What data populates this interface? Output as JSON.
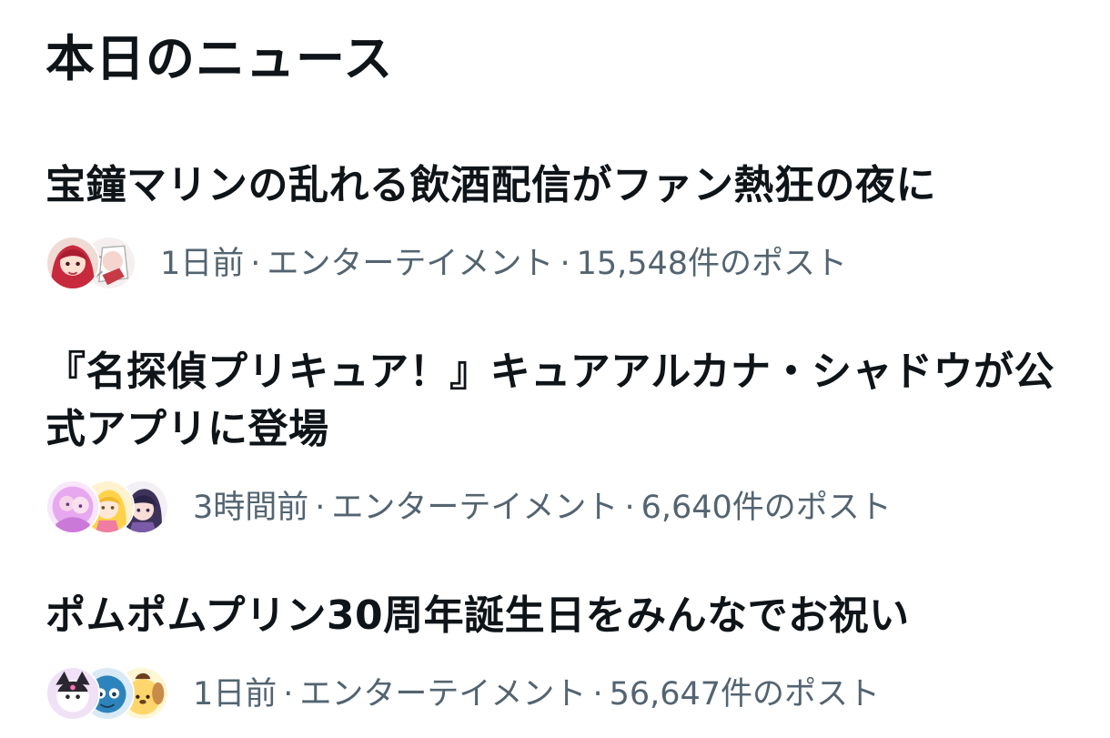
{
  "section": {
    "title": "本日のニュース"
  },
  "news_items": [
    {
      "headline": "宝鐘マリンの乱れる飲酒配信がファン熱狂の夜に",
      "time": "1日前",
      "category": "エンターテイメント",
      "posts": "15,548件のポスト",
      "separator": "·",
      "avatar_colors": [
        "#c9273a",
        "#f4f0ee"
      ]
    },
    {
      "headline": "『名探偵プリキュア！』キュアアルカナ・シャドウが公式アプリに登場",
      "time": "3時間前",
      "category": "エンターテイメント",
      "posts": "6,640件のポスト",
      "separator": "·",
      "avatar_colors": [
        "#e8a7ee",
        "#ffd24a",
        "#4b3a70"
      ]
    },
    {
      "headline": "ポムポムプリン30周年誕生日をみんなでお祝い",
      "time": "1日前",
      "category": "エンターテイメント",
      "posts": "56,647件のポスト",
      "separator": "·",
      "avatar_colors": [
        "#d8b7ef",
        "#2d84bd",
        "#ffd66b"
      ]
    }
  ]
}
